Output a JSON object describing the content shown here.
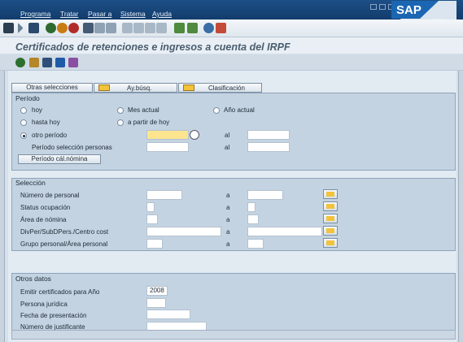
{
  "menubar": {
    "items": [
      "Programa",
      "Tratar",
      "Pasar a",
      "Sistema",
      "Ayuda"
    ],
    "logo": "SAP",
    "window_buttons": [
      "minimize-icon",
      "restore-icon",
      "close-icon"
    ]
  },
  "toolbar": {
    "icons": [
      "enter-icon",
      "command-field-icon",
      "save-icon",
      "back-icon",
      "exit-icon",
      "cancel-icon",
      "print-icon",
      "find-icon",
      "find-next-icon",
      "first-page-icon",
      "previous-page-icon",
      "next-page-icon",
      "last-page-icon",
      "new-session-icon",
      "shortcut-icon",
      "help-icon",
      "layout-icon"
    ]
  },
  "title": "Certificados de retenciones e ingresos a cuenta del IRPF",
  "app_toolbar": {
    "icons": [
      "execute-icon",
      "get-variant-icon",
      "save-variant-icon",
      "info-icon",
      "selection-options-icon"
    ]
  },
  "tabs": {
    "other_selections": "Otras selecciones",
    "search_help": "Ay.búsq.",
    "sort": "Clasificación"
  },
  "periodo": {
    "label": "Período",
    "hoy": "hoy",
    "mes_actual": "Mes actual",
    "ano_actual": "Año actual",
    "hasta_hoy": "hasta hoy",
    "a_partir_de_hoy": "a partir de hoy",
    "otro_periodo": "otro período",
    "periodo_seleccion_personas": "Período selección personas",
    "al": "al",
    "calc_nomina_button": "Período cál.nómina",
    "selected": "otro_periodo"
  },
  "seleccion": {
    "label": "Selección",
    "rows": [
      {
        "label": "Número de personal",
        "to": "a"
      },
      {
        "label": "Status ocupación",
        "to": "a"
      },
      {
        "label": "Área de nómina",
        "to": "a"
      },
      {
        "label": "DivPer/SubDPers./Centro cost",
        "to": "a"
      },
      {
        "label": "Grupo personal/Área personal",
        "to": "a"
      }
    ]
  },
  "otros_datos": {
    "label": "Otros datos",
    "fields": [
      {
        "label": "Emitir certificados para Año",
        "value": "2008"
      },
      {
        "label": "Persona jurídica",
        "value": ""
      },
      {
        "label": "Fecha de presentación",
        "value": ""
      },
      {
        "label": "Número de justificante",
        "value": ""
      }
    ]
  },
  "colors": {
    "menubar": "#1d4f87",
    "title_text": "#4a5d6f",
    "group_bg": "#c4d3e1",
    "required_field": "#fde590"
  }
}
